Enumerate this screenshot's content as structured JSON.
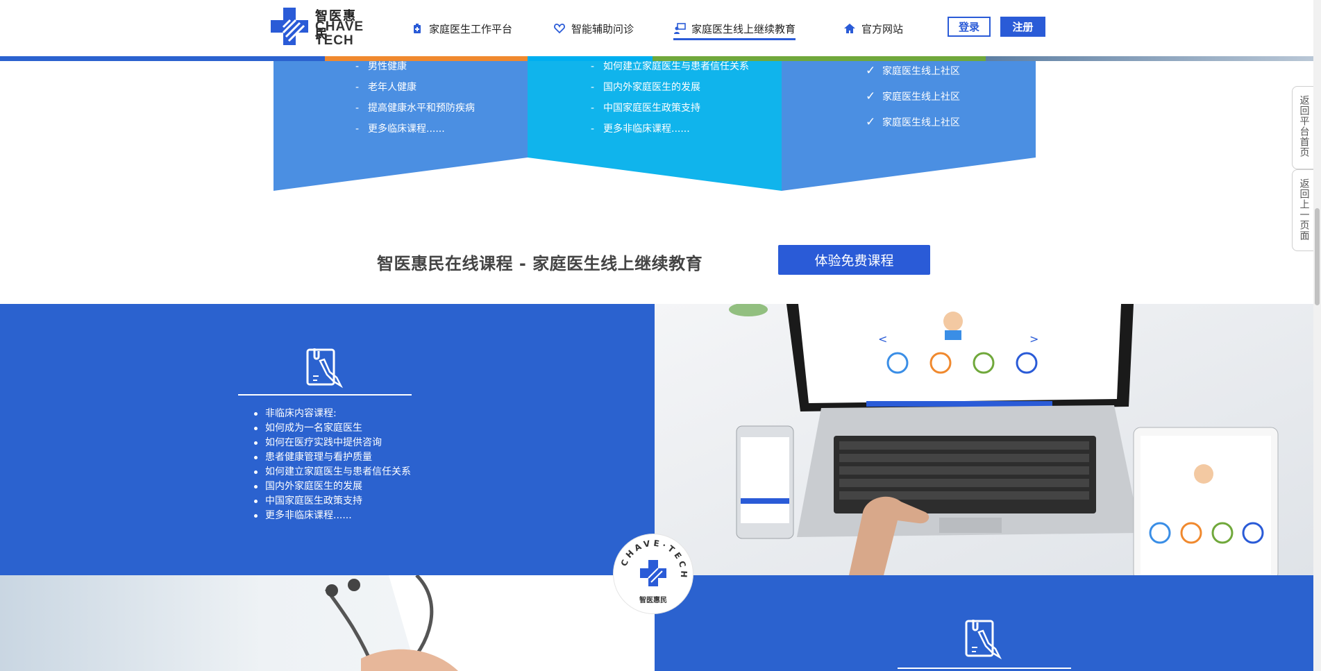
{
  "header": {
    "brand_cn": "智医惠民",
    "brand_en_line1": "CHAVE",
    "brand_en_line2": "TECH",
    "nav": [
      {
        "label": "家庭医生工作平台",
        "icon": "medical-kit-icon"
      },
      {
        "label": "智能辅助问诊",
        "icon": "heart-icon"
      },
      {
        "label": "家庭医生线上继续教育",
        "icon": "teacher-icon",
        "active": true
      },
      {
        "label": "官方网站",
        "icon": "home-icon"
      }
    ],
    "login_label": "登录",
    "register_label": "注册"
  },
  "ribbon": {
    "col1": [
      "男性健康",
      "老年人健康",
      "提高健康水平和预防疾病",
      "更多临床课程......"
    ],
    "col2": [
      "如何建立家庭医生与患者信任关系",
      "国内外家庭医生的发展",
      "中国家庭医生政策支持",
      "更多非临床课程......"
    ],
    "col3": [
      "家庭医生线上社区",
      "家庭医生线上社区",
      "家庭医生线上社区"
    ]
  },
  "promo": {
    "title": "智医惠民在线课程 - 家庭医生线上继续教育",
    "button_label": "体验免费课程"
  },
  "nonclinical": {
    "items": [
      "非临床内容课程:",
      "如何成为一名家庭医生",
      "如何在医疗实践中提供咨询",
      "患者健康管理与看护质量",
      "如何建立家庭医生与患者信任关系",
      "国内外家庭医生的发展",
      "中国家庭医生政策支持",
      "更多非临床课程......"
    ]
  },
  "badge": {
    "ring_text": "CHAVE·TECH",
    "brand_cn": "智医惠民"
  },
  "side": {
    "back_home": "返回平台首页",
    "back_prev": "返回上一页面"
  },
  "colors": {
    "primary_blue": "#2a5bd7",
    "ribbon_blue": "#4b8fe2",
    "ribbon_cyan": "#10b4ec",
    "stripe": [
      "#2b62cf",
      "#f0892e",
      "#00aff0",
      "#70a83b",
      "#5d7fa3"
    ]
  }
}
